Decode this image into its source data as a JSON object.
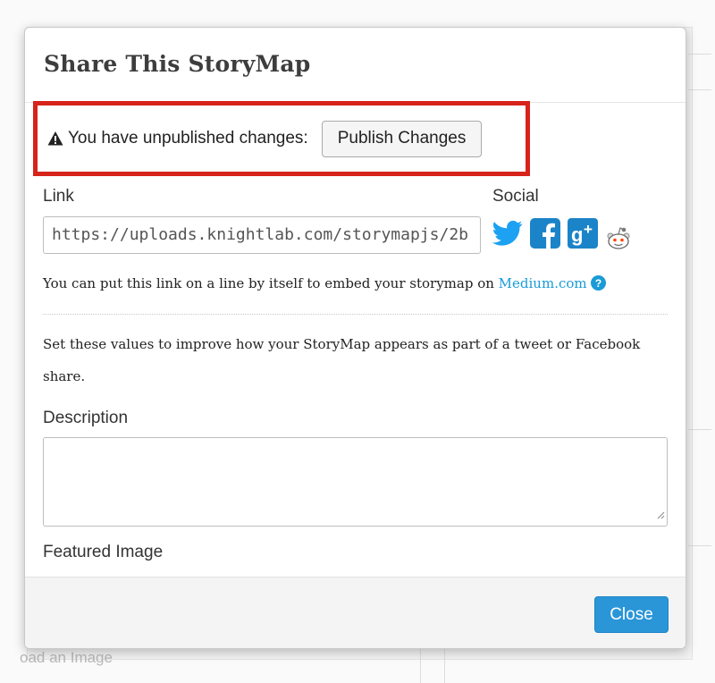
{
  "modal": {
    "title": "Share This StoryMap",
    "warning": {
      "text": "You have unpublished changes:",
      "publish_label": "Publish Changes"
    },
    "link": {
      "label": "Link",
      "value": "https://uploads.knightlab.com/storymapjs/2b"
    },
    "social": {
      "label": "Social",
      "icons": [
        "twitter-icon",
        "facebook-icon",
        "google-plus-icon",
        "reddit-icon"
      ]
    },
    "medium_note": {
      "text": "You can put this link on a line by itself to embed your storymap on ",
      "link_text": "Medium.com"
    },
    "set_values_text": "Set these values to improve how your StoryMap appears as part of a tweet or Facebook share.",
    "description_label": "Description",
    "description_value": "",
    "featured_image_label": "Featured Image",
    "close_label": "Close"
  },
  "background": {
    "partial_text": "oad an Image"
  },
  "colors": {
    "accent": "#2a96d8",
    "link": "#1a9bd7",
    "warning_border": "#d6241b",
    "twitter": "#1da1f2",
    "facebook": "#1b84c8"
  }
}
